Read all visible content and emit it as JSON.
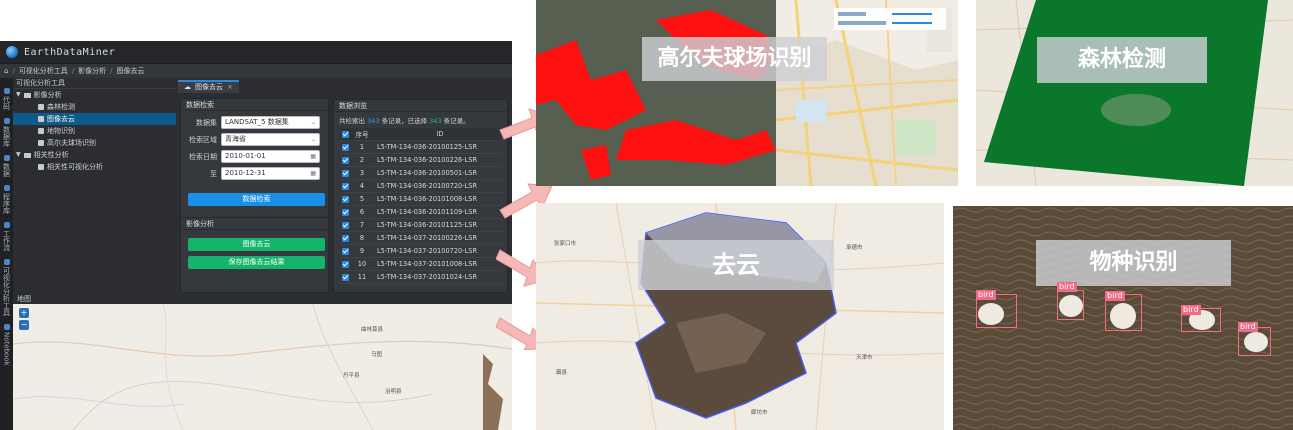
{
  "app": {
    "title": "EarthDataMiner",
    "breadcrumb": [
      "可视化分析工具",
      "影像分析",
      "图像去云"
    ],
    "left_strip": [
      "代码",
      "数据库",
      "数据",
      "程序库",
      "工作流",
      "可视化分析工具",
      "Notebook"
    ],
    "tree": {
      "header": "可视化分析工具",
      "items": [
        {
          "label": "影像分析",
          "level": 0,
          "expanded": true
        },
        {
          "label": "森林检测",
          "level": 1
        },
        {
          "label": "图像去云",
          "level": 1,
          "selected": true
        },
        {
          "label": "地物识别",
          "level": 1
        },
        {
          "label": "高尔夫球场识别",
          "level": 1
        },
        {
          "label": "相关性分析",
          "level": 0,
          "expanded": true
        },
        {
          "label": "相关性可视化分析",
          "level": 1
        }
      ]
    },
    "tab": {
      "label": "图像去云",
      "close": "×"
    },
    "search_panel": {
      "title": "数据检索",
      "dataset_label": "数据集",
      "dataset_value": "LANDSAT_5 数据集",
      "region_label": "检索区域",
      "region_value": "青海省",
      "date_label": "检索日期",
      "date_from": "2010-01-01",
      "to_label": "至",
      "date_to": "2010-12-31",
      "search_button": "数据检索"
    },
    "analysis_panel": {
      "title": "影像分析",
      "declouding_button": "图像去云",
      "save_button": "保存图像去云结果"
    },
    "browse_panel": {
      "title": "数据浏览",
      "count_prefix": "共检索出",
      "count_found": "343",
      "count_mid": "条记录，已选择",
      "count_selected": "343",
      "count_suffix": "条记录。",
      "columns": {
        "no": "序号",
        "id": "ID"
      },
      "rows": [
        {
          "no": "1",
          "id": "L5-TM-134-036-20100125-LSR"
        },
        {
          "no": "2",
          "id": "L5-TM-134-036-20100226-LSR"
        },
        {
          "no": "3",
          "id": "L5-TM-134-036-20100501-LSR"
        },
        {
          "no": "4",
          "id": "L5-TM-134-036-20100720-LSR"
        },
        {
          "no": "5",
          "id": "L5-TM-134-036-20101008-LSR"
        },
        {
          "no": "6",
          "id": "L5-TM-134-036-20101109-LSR"
        },
        {
          "no": "7",
          "id": "L5-TM-134-036-20101125-LSR"
        },
        {
          "no": "8",
          "id": "L5-TM-134-037-20100226-LSR"
        },
        {
          "no": "9",
          "id": "L5-TM-134-037-20100720-LSR"
        },
        {
          "no": "10",
          "id": "L5-TM-134-037-20101008-LSR"
        },
        {
          "no": "11",
          "id": "L5-TM-134-037-20101024-LSR"
        }
      ]
    },
    "map": {
      "title": "地图",
      "zoom_in": "+",
      "zoom_out": "−",
      "places": [
        "曲林莫县",
        "乌图",
        "丹平县",
        "治明县"
      ]
    }
  },
  "results": {
    "golf": {
      "label": "高尔夫球场识别"
    },
    "forest": {
      "label": "森林检测"
    },
    "cloud": {
      "label": "去云",
      "places": [
        "张家口市",
        "承德市",
        "天津市",
        "廊坊市",
        "霸县"
      ]
    },
    "species": {
      "label": "物种识别",
      "detection_label": "bird"
    }
  },
  "colors": {
    "accent_blue": "#1890e8",
    "accent_green": "#13b56a",
    "arrow_fill": "#f6b7b7",
    "detection_box": "#f06a8a"
  }
}
